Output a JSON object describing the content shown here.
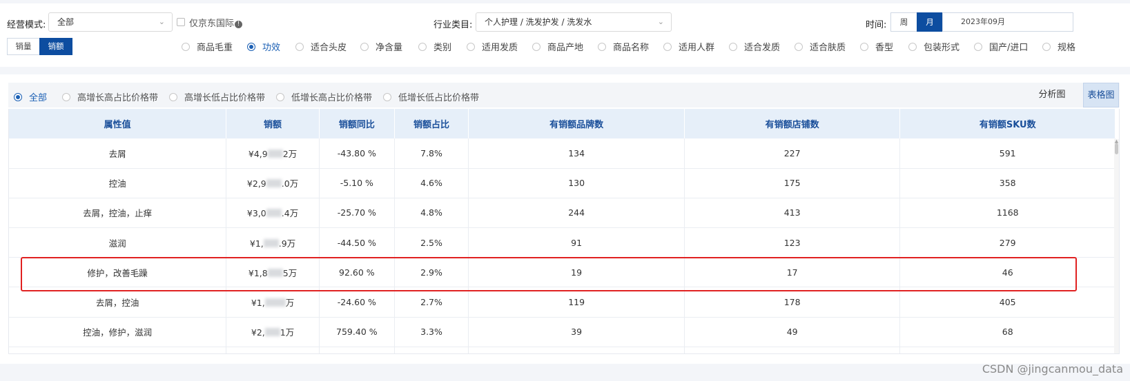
{
  "filters": {
    "mode_label": "经营模式:",
    "mode_value": "全部",
    "jd_intl_label": "仅京东国际",
    "category_label": "行业类目:",
    "category_value": "个人护理 / 洗发护发 / 洗发水",
    "time_label": "时间:",
    "period_week": "周",
    "period_month": "月",
    "date_value": "2023年09月"
  },
  "metric_toggle": {
    "volume": "销量",
    "amount": "销额"
  },
  "attributes": [
    "商品毛重",
    "功效",
    "适合头皮",
    "净含量",
    "类别",
    "适用发质",
    "商品产地",
    "商品名称",
    "适用人群",
    "适合发质",
    "适合肤质",
    "香型",
    "包装形式",
    "国产/进口",
    "规格"
  ],
  "selected_attribute": "功效",
  "price_bands": [
    "全部",
    "高增长高占比价格带",
    "高增长低占比价格带",
    "低增长高占比价格带",
    "低增长低占比价格带"
  ],
  "view_toggle": {
    "chart": "分析图",
    "table": "表格图"
  },
  "table": {
    "headers": [
      "属性值",
      "销额",
      "销额同比",
      "销额占比",
      "有销额品牌数",
      "有销额店铺数",
      "有销额SKU数"
    ],
    "rows": [
      {
        "attr": "去屑",
        "amount_pre": "¥4,9",
        "amount_post": "2万",
        "yoy": "-43.80 %",
        "share": "7.8%",
        "brands": "134",
        "shops": "227",
        "sku": "591"
      },
      {
        "attr": "控油",
        "amount_pre": "¥2,9",
        "amount_post": ".0万",
        "yoy": "-5.10 %",
        "share": "4.6%",
        "brands": "130",
        "shops": "175",
        "sku": "358"
      },
      {
        "attr": "去屑，控油，止痒",
        "amount_pre": "¥3,0",
        "amount_post": ".4万",
        "yoy": "-25.70 %",
        "share": "4.8%",
        "brands": "244",
        "shops": "413",
        "sku": "1168"
      },
      {
        "attr": "滋润",
        "amount_pre": "¥1,",
        "amount_post": ".9万",
        "yoy": "-44.50 %",
        "share": "2.5%",
        "brands": "91",
        "shops": "123",
        "sku": "279"
      },
      {
        "attr": "修护，改善毛躁",
        "amount_pre": "¥1,8",
        "amount_post": "5万",
        "yoy": "92.60 %",
        "share": "2.9%",
        "brands": "19",
        "shops": "17",
        "sku": "46"
      },
      {
        "attr": "去屑，控油",
        "amount_pre": "¥1,",
        "amount_post": "万",
        "yoy": "-24.60 %",
        "share": "2.7%",
        "brands": "119",
        "shops": "178",
        "sku": "405"
      },
      {
        "attr": "控油，修护，滋润",
        "amount_pre": "¥2,",
        "amount_post": "1万",
        "yoy": "759.40 %",
        "share": "3.3%",
        "brands": "39",
        "shops": "49",
        "sku": "68"
      }
    ]
  },
  "colors": {
    "primary": "#0d4da0",
    "highlight": "#e02020",
    "header_bg": "#e6eff9"
  },
  "watermark": "CSDN @jingcanmou_data"
}
